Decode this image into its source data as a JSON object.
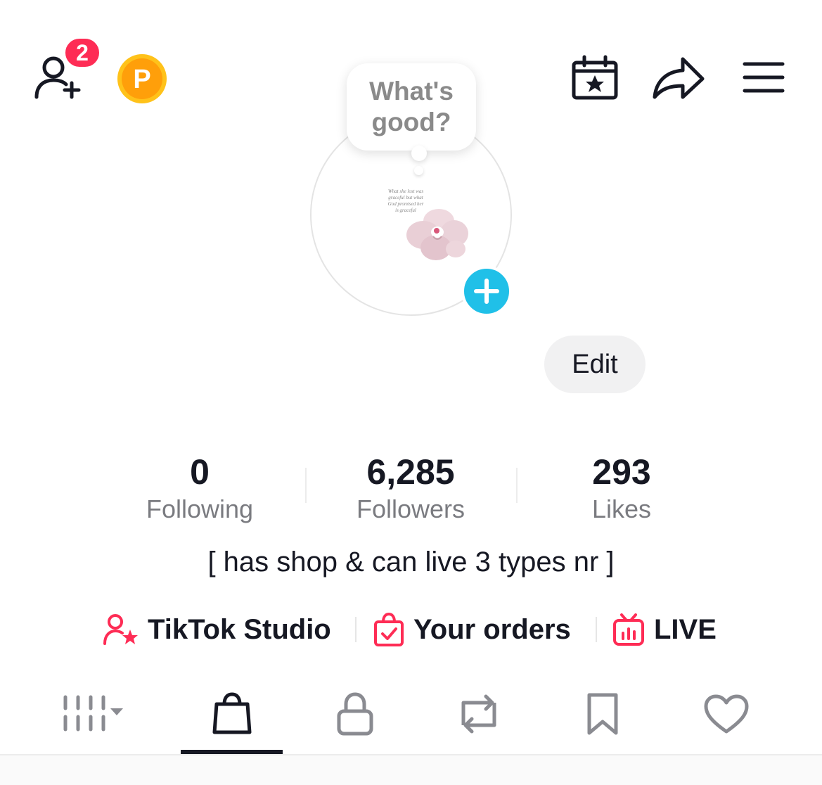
{
  "header": {
    "friend_request_count": "2",
    "coin_letter": "P"
  },
  "avatar": {
    "thought_line1": "What's",
    "thought_line2": "good?",
    "caption": "What she lost was graceful but what God promised her is graceful"
  },
  "profile": {
    "edit_label": "Edit",
    "bio": "[ has shop & can live 3 types nr ]"
  },
  "stats": {
    "following": {
      "value": "0",
      "label": "Following"
    },
    "followers": {
      "value": "6,285",
      "label": "Followers"
    },
    "likes": {
      "value": "293",
      "label": "Likes"
    }
  },
  "quick_links": {
    "studio": "TikTok Studio",
    "orders": "Your orders",
    "live": "LIVE"
  },
  "tabs": {
    "items": [
      "videos-grid",
      "shop",
      "private",
      "reposts",
      "favorites",
      "liked"
    ],
    "active": "shop"
  },
  "colors": {
    "accent_pink": "#fe2c55",
    "cyan": "#20c0e8",
    "coin_orange": "#ff9f0a",
    "text": "#161823",
    "muted": "#7a7b80"
  }
}
